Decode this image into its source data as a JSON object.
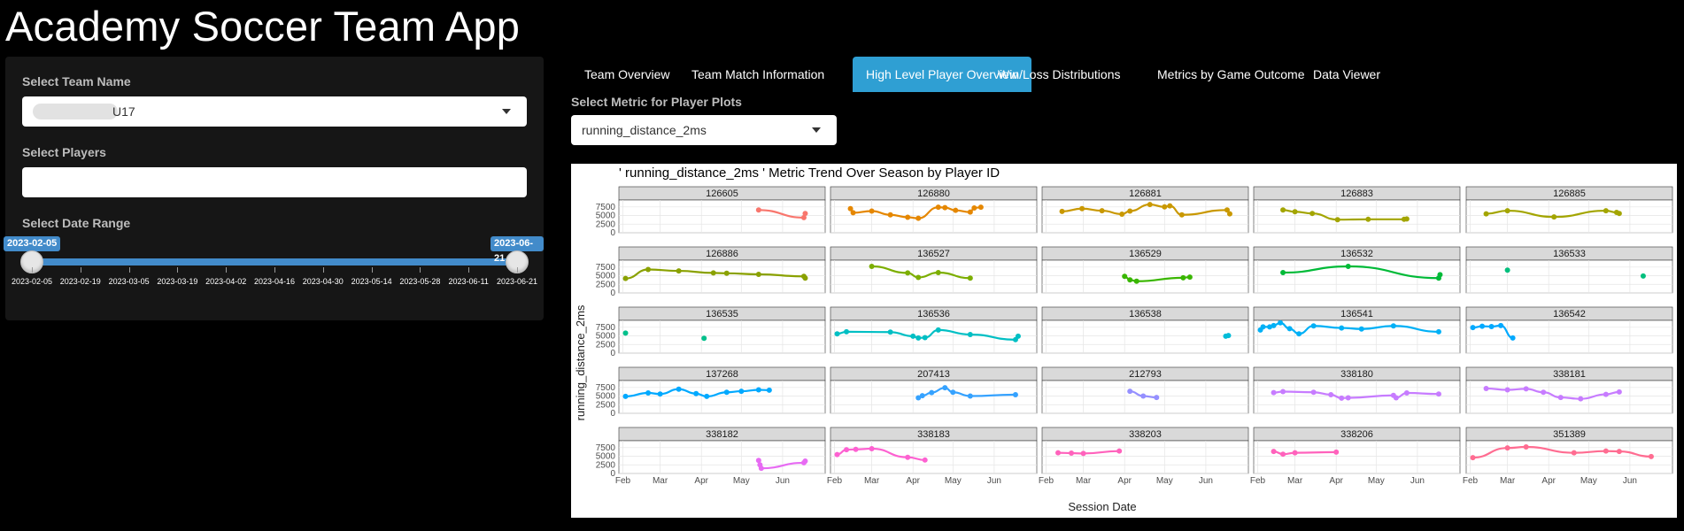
{
  "app": {
    "title": "Academy Soccer Team App"
  },
  "sidebar": {
    "team_label": "Select Team Name",
    "team_value": "U17",
    "players_label": "Select Players",
    "players_value": "",
    "date_label": "Select Date Range",
    "date_start": "2023-02-05",
    "date_end": "2023-06-21",
    "ticks": [
      "2023-02-05",
      "2023-02-19",
      "2023-03-05",
      "2023-03-19",
      "2023-04-02",
      "2023-04-16",
      "2023-04-30",
      "2023-05-14",
      "2023-05-28",
      "2023-06-11",
      "2023-06-21"
    ]
  },
  "tabs": [
    {
      "label": "Team Overview",
      "active": false
    },
    {
      "label": "Team Match Information",
      "active": false
    },
    {
      "label": "High Level Player Overview",
      "active": true
    },
    {
      "label": "Win/Loss Distributions",
      "active": false
    },
    {
      "label": "Metrics by Game Outcome",
      "active": false
    },
    {
      "label": "Data Viewer",
      "active": false
    }
  ],
  "metric": {
    "label": "Select Metric for Player Plots",
    "value": "running_distance_2ms"
  },
  "chart_data": {
    "type": "scatter",
    "title": "' running_distance_2ms ' Metric Trend Over Season by Player ID",
    "xlabel": "Session Date",
    "ylabel": "running_distance_2ms",
    "x_ticks": [
      "Feb",
      "Mar",
      "Apr",
      "May",
      "Jun"
    ],
    "y_ticks": [
      0,
      2500,
      5000,
      7500
    ],
    "ylim": [
      0,
      9500
    ],
    "grid": true,
    "panels": [
      {
        "id": "126605",
        "color": "#f8766d",
        "x": [
          "2023-05-14",
          "2023-06-17",
          "2023-06-18"
        ],
        "y": [
          6600,
          4400,
          5600
        ]
      },
      {
        "id": "126880",
        "color": "#e58700",
        "x": [
          "2023-02-13",
          "2023-02-15",
          "2023-03-01",
          "2023-03-15",
          "2023-03-28",
          "2023-04-05",
          "2023-04-20",
          "2023-04-25",
          "2023-05-03",
          "2023-05-14",
          "2023-05-17",
          "2023-05-22"
        ],
        "y": [
          7000,
          5800,
          6300,
          5200,
          4500,
          4200,
          7400,
          7300,
          6500,
          6000,
          7200,
          7400
        ]
      },
      {
        "id": "126881",
        "color": "#c99800",
        "x": [
          "2023-02-13",
          "2023-02-28",
          "2023-03-15",
          "2023-03-30",
          "2023-04-05",
          "2023-04-20",
          "2023-05-01",
          "2023-05-05",
          "2023-05-14",
          "2023-06-17",
          "2023-06-19"
        ],
        "y": [
          6200,
          7000,
          6400,
          5400,
          6300,
          8200,
          7500,
          7800,
          5200,
          6600,
          5500
        ]
      },
      {
        "id": "126883",
        "color": "#a3a500",
        "x": [
          "2023-02-20",
          "2023-03-01",
          "2023-03-14",
          "2023-04-02",
          "2023-04-25",
          "2023-05-22",
          "2023-05-24"
        ],
        "y": [
          6600,
          6100,
          5600,
          3800,
          3900,
          3900,
          4000
        ]
      },
      {
        "id": "126885",
        "color": "#a3a500",
        "x": [
          "2023-02-13",
          "2023-03-01",
          "2023-04-05",
          "2023-05-14",
          "2023-05-22",
          "2023-05-24"
        ],
        "y": [
          5500,
          6400,
          4600,
          6400,
          5900,
          5600
        ]
      },
      {
        "id": "126886",
        "color": "#8aa100",
        "x": [
          "2023-02-03",
          "2023-02-20",
          "2023-03-15",
          "2023-04-10",
          "2023-04-20",
          "2023-05-14",
          "2023-06-17",
          "2023-06-18"
        ],
        "y": [
          4200,
          6800,
          6400,
          5800,
          5700,
          5400,
          4800,
          4300
        ]
      },
      {
        "id": "136527",
        "color": "#7cae00",
        "x": [
          "2023-03-01",
          "2023-03-28",
          "2023-04-05",
          "2023-04-20",
          "2023-05-14"
        ],
        "y": [
          7700,
          5800,
          4500,
          5900,
          4300
        ]
      },
      {
        "id": "136529",
        "color": "#39b600",
        "x": [
          "2023-04-01",
          "2023-04-05",
          "2023-04-10",
          "2023-05-15",
          "2023-05-20"
        ],
        "y": [
          4800,
          3800,
          3400,
          4400,
          4600
        ]
      },
      {
        "id": "136532",
        "color": "#00ba38",
        "x": [
          "2023-02-20",
          "2023-04-10",
          "2023-06-17",
          "2023-06-18"
        ],
        "y": [
          5900,
          7700,
          4300,
          5300
        ]
      },
      {
        "id": "136533",
        "color": "#00bf7d",
        "x": [
          "2023-03-01",
          "2023-06-11"
        ],
        "y": [
          6600,
          4900
        ]
      },
      {
        "id": "136535",
        "color": "#00c08b",
        "x": [
          "2023-02-03",
          "2023-04-03"
        ],
        "y": [
          5800,
          4300
        ]
      },
      {
        "id": "136536",
        "color": "#00bfc4",
        "x": [
          "2023-02-03",
          "2023-02-10",
          "2023-03-15",
          "2023-04-01",
          "2023-04-05",
          "2023-04-10",
          "2023-04-20",
          "2023-05-14",
          "2023-06-17",
          "2023-06-19"
        ],
        "y": [
          5600,
          6200,
          6100,
          4900,
          4400,
          4500,
          6700,
          5400,
          3900,
          4900
        ]
      },
      {
        "id": "136538",
        "color": "#00bcd8",
        "x": [
          "2023-06-16",
          "2023-06-18"
        ],
        "y": [
          4900,
          5100
        ]
      },
      {
        "id": "136541",
        "color": "#00b0f6",
        "x": [
          "2023-02-03",
          "2023-02-05",
          "2023-02-10",
          "2023-02-13",
          "2023-02-18",
          "2023-02-25",
          "2023-03-04",
          "2023-03-15",
          "2023-04-05",
          "2023-04-20",
          "2023-05-14",
          "2023-06-17"
        ],
        "y": [
          6700,
          7600,
          7600,
          8000,
          8800,
          7100,
          5600,
          7900,
          7300,
          7000,
          7900,
          6200
        ]
      },
      {
        "id": "136542",
        "color": "#00a9ff",
        "x": [
          "2023-02-03",
          "2023-02-10",
          "2023-02-17",
          "2023-02-24",
          "2023-03-05"
        ],
        "y": [
          7400,
          7800,
          7700,
          8000,
          4400
        ]
      },
      {
        "id": "137268",
        "color": "#00a9ff",
        "x": [
          "2023-02-03",
          "2023-02-20",
          "2023-03-01",
          "2023-03-15",
          "2023-03-28",
          "2023-04-05",
          "2023-04-20",
          "2023-05-01",
          "2023-05-14",
          "2023-05-22"
        ],
        "y": [
          4900,
          5900,
          5600,
          7000,
          5700,
          4900,
          6100,
          6400,
          6800,
          6700
        ]
      },
      {
        "id": "207413",
        "color": "#35a2ff",
        "x": [
          "2023-04-05",
          "2023-04-08",
          "2023-04-15",
          "2023-04-25",
          "2023-05-01",
          "2023-05-14",
          "2023-06-17"
        ],
        "y": [
          4500,
          5100,
          6000,
          7400,
          6100,
          5000,
          5400
        ]
      },
      {
        "id": "212793",
        "color": "#9590ff",
        "x": [
          "2023-04-05",
          "2023-04-15",
          "2023-04-25"
        ],
        "y": [
          6400,
          5000,
          4600
        ]
      },
      {
        "id": "338180",
        "color": "#c77cff",
        "x": [
          "2023-02-13",
          "2023-02-20",
          "2023-03-15",
          "2023-03-28",
          "2023-04-05",
          "2023-04-10",
          "2023-05-14",
          "2023-05-16",
          "2023-05-24",
          "2023-06-17"
        ],
        "y": [
          6000,
          6300,
          6100,
          5400,
          4400,
          4500,
          5200,
          4500,
          5900,
          5600
        ]
      },
      {
        "id": "338181",
        "color": "#c77cff",
        "x": [
          "2023-02-13",
          "2023-03-01",
          "2023-03-15",
          "2023-03-28",
          "2023-04-10",
          "2023-04-25",
          "2023-05-14",
          "2023-05-24"
        ],
        "y": [
          7200,
          6800,
          7100,
          6100,
          4600,
          4200,
          5500,
          6200
        ]
      },
      {
        "id": "338182",
        "color": "#e76bf3",
        "x": [
          "2023-05-14",
          "2023-05-15",
          "2023-05-16",
          "2023-06-17",
          "2023-06-18"
        ],
        "y": [
          3800,
          2500,
          1500,
          3100,
          3600
        ]
      },
      {
        "id": "338183",
        "color": "#fd61d1",
        "x": [
          "2023-02-03",
          "2023-02-10",
          "2023-02-17",
          "2023-03-01",
          "2023-03-28",
          "2023-04-10"
        ],
        "y": [
          5500,
          6900,
          7000,
          7200,
          4700,
          3900
        ]
      },
      {
        "id": "338203",
        "color": "#ff62bc",
        "x": [
          "2023-02-10",
          "2023-02-20",
          "2023-03-01",
          "2023-03-28"
        ],
        "y": [
          6000,
          5900,
          5800,
          6500
        ]
      },
      {
        "id": "338206",
        "color": "#ff62bc",
        "x": [
          "2023-02-13",
          "2023-02-20",
          "2023-03-01",
          "2023-04-01"
        ],
        "y": [
          6400,
          5600,
          6000,
          6200
        ]
      },
      {
        "id": "351389",
        "color": "#ff6c91",
        "x": [
          "2023-02-03",
          "2023-03-01",
          "2023-03-15",
          "2023-04-20",
          "2023-05-14",
          "2023-05-24",
          "2023-06-17"
        ],
        "y": [
          4600,
          7400,
          7700,
          6000,
          6500,
          6400,
          4900
        ]
      }
    ]
  }
}
